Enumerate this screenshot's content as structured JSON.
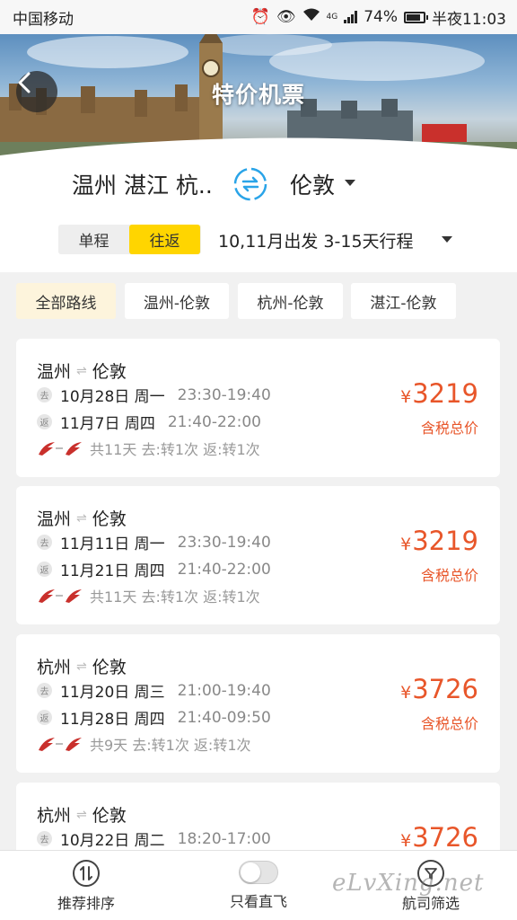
{
  "status_bar": {
    "carrier": "中国移动",
    "network": "4G",
    "battery": "74%",
    "time": "半夜11:03"
  },
  "header": {
    "title": "特价机票"
  },
  "search": {
    "origin": "温州 湛江 杭..",
    "destination": "伦敦",
    "trip_types": [
      "单程",
      "往返"
    ],
    "selected_trip_type": "往返",
    "depart_filter": "10,11月出发 3-15天行程"
  },
  "route_filters": [
    "全部路线",
    "温州-伦敦",
    "杭州-伦敦",
    "湛江-伦敦"
  ],
  "route_filters_selected": "全部路线",
  "leg_tags": {
    "out": "去",
    "return": "返"
  },
  "currency_symbol": "¥",
  "flights": [
    {
      "from": "温州",
      "to": "伦敦",
      "out_date": "10月28日 周一",
      "out_time": "23:30-19:40",
      "ret_date": "11月7日 周四",
      "ret_time": "21:40-22:00",
      "summary": "共11天 去:转1次 返:转1次",
      "price": "3219",
      "price_label": "含税总价"
    },
    {
      "from": "温州",
      "to": "伦敦",
      "out_date": "11月11日 周一",
      "out_time": "23:30-19:40",
      "ret_date": "11月21日 周四",
      "ret_time": "21:40-22:00",
      "summary": "共11天 去:转1次 返:转1次",
      "price": "3219",
      "price_label": "含税总价"
    },
    {
      "from": "杭州",
      "to": "伦敦",
      "out_date": "11月20日 周三",
      "out_time": "21:00-19:40",
      "ret_date": "11月28日 周四",
      "ret_time": "21:40-09:50",
      "summary": "共9天 去:转1次 返:转1次",
      "price": "3726",
      "price_label": "含税总价"
    },
    {
      "from": "杭州",
      "to": "伦敦",
      "out_date": "10月22日 周二",
      "out_time": "18:20-17:00",
      "price": "3726"
    }
  ],
  "bottom_bar": {
    "sort": "推荐排序",
    "direct_only": "只看直飞",
    "filter": "航司筛选"
  },
  "watermark": "eLvXing.net",
  "colors": {
    "accent_yellow": "#ffd500",
    "price_orange": "#e8562a",
    "swap_blue": "#2aa4e8"
  }
}
